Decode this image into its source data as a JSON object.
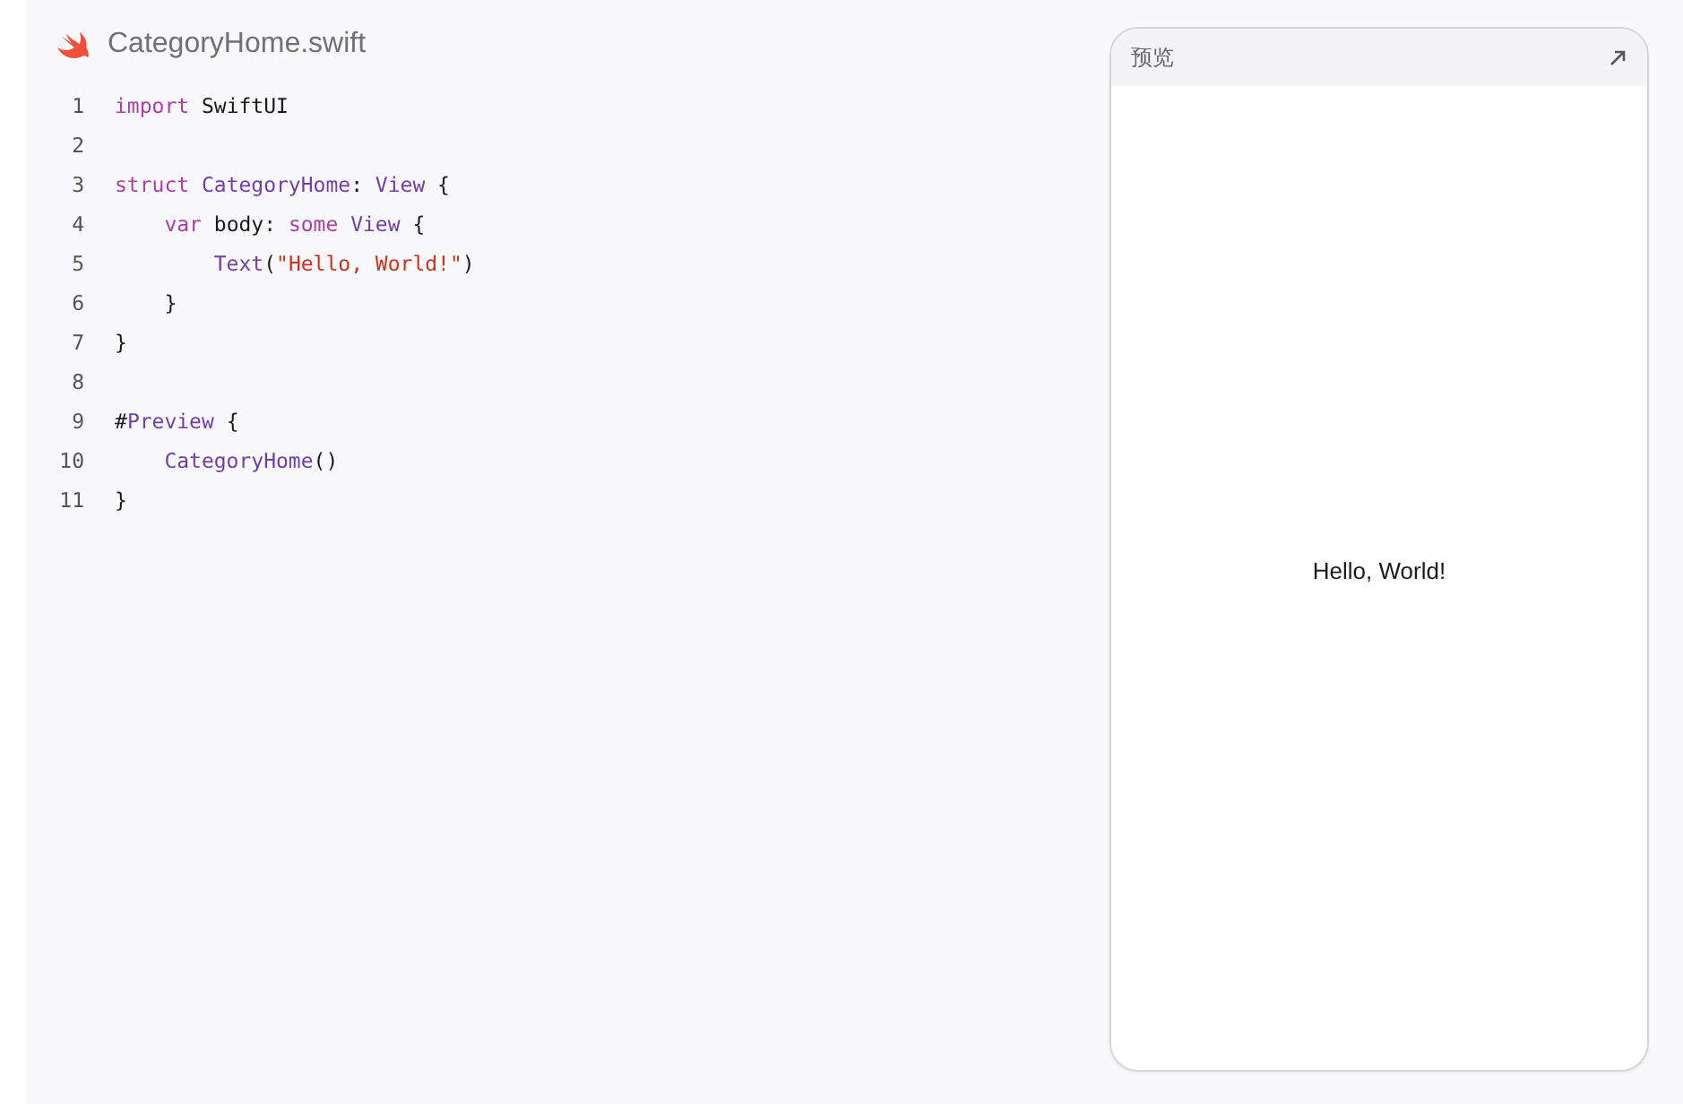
{
  "file": {
    "name": "CategoryHome.swift"
  },
  "code": [
    {
      "number": "1",
      "tokens": [
        {
          "kind": "keyword",
          "text": "import"
        },
        {
          "kind": "plain",
          "text": " SwiftUI"
        }
      ]
    },
    {
      "number": "2"
    },
    {
      "number": "3",
      "tokens": [
        {
          "kind": "keyword",
          "text": "struct "
        },
        {
          "kind": "type",
          "text": "CategoryHome"
        },
        {
          "kind": "plain",
          "text": ": "
        },
        {
          "kind": "type",
          "text": "View"
        },
        {
          "kind": "plain",
          "text": " {"
        }
      ]
    },
    {
      "number": "4",
      "tokens": [
        {
          "kind": "keyword",
          "text": "    var"
        },
        {
          "kind": "plain",
          "text": " body: "
        },
        {
          "kind": "keyword",
          "text": "some "
        },
        {
          "kind": "type",
          "text": "View"
        },
        {
          "kind": "plain",
          "text": " {"
        }
      ]
    },
    {
      "number": "5",
      "tokens": [
        {
          "kind": "type",
          "text": "        Text"
        },
        {
          "kind": "plain",
          "text": "("
        },
        {
          "kind": "string",
          "text": "\"Hello, World!\""
        },
        {
          "kind": "plain",
          "text": ")"
        }
      ]
    },
    {
      "number": "6",
      "tokens": [
        {
          "kind": "plain",
          "text": "    }"
        }
      ]
    },
    {
      "number": "7",
      "tokens": [
        {
          "kind": "plain",
          "text": "}"
        }
      ]
    },
    {
      "number": "8"
    },
    {
      "number": "9",
      "tokens": [
        {
          "kind": "plain",
          "text": "#"
        },
        {
          "kind": "type",
          "text": "Preview"
        },
        {
          "kind": "plain",
          "text": " {"
        }
      ]
    },
    {
      "number": "10",
      "tokens": [
        {
          "kind": "type",
          "text": "    CategoryHome"
        },
        {
          "kind": "plain",
          "text": "()"
        }
      ]
    },
    {
      "number": "11",
      "tokens": [
        {
          "kind": "plain",
          "text": "}"
        }
      ]
    }
  ],
  "preview": {
    "title": "预览",
    "content": "Hello, World!"
  }
}
